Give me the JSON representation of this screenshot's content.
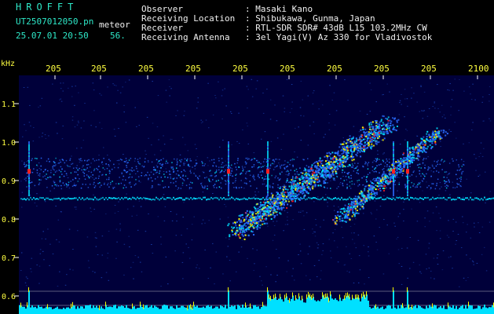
{
  "header": {
    "brand": "HROFFT",
    "filename": "UT2507012050.pn",
    "file_suffix": "meteor",
    "datetime": "25.07.01 20:50",
    "count": "56.",
    "info_labels": [
      "Observer",
      "Receiving Location",
      "Receiver",
      "Receiving Antenna"
    ],
    "info_values": [
      ": Masaki Kano",
      ": Shibukawa, Gunma, Japan",
      ": RTL-SDR SDR# 43dB L15 103.2MHz CW",
      ": 3el Yagi(V) Az 330 for Vladivostok"
    ]
  },
  "spectrogram": {
    "y_unit": "kHz",
    "y_ticks": [
      "1.1",
      "1.0",
      "0.9",
      "0.8",
      "0.7",
      "0.6"
    ],
    "y_tick_values": [
      1.1,
      1.0,
      0.9,
      0.8,
      0.7,
      0.6
    ],
    "time_labels": [
      "205",
      "205",
      "205",
      "205",
      "205",
      "205",
      "205",
      "205",
      "205",
      "2100"
    ],
    "colors": {
      "background": "#00003a",
      "axis_text": "#ffff40",
      "grid": "#ffffff",
      "signal_low": "#2a6cff",
      "signal_mid": "#00e0ff",
      "signal_high": "#ffff00",
      "signal_peak": "#ff2020",
      "histogram_fill": "#00e0ff",
      "histogram_peak": "#ffff00"
    }
  }
}
